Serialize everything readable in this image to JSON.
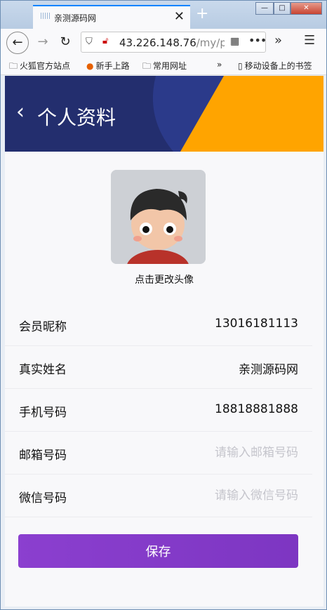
{
  "browser": {
    "tab_title": "亲测源码网",
    "url_host": "43.226.148.76",
    "url_path": "/my/prof",
    "bookmarks": [
      "火狐官方站点",
      "新手上路",
      "常用网址",
      "移动设备上的书签"
    ]
  },
  "header": {
    "title": "个人资料",
    "bg_color": "#232e6e",
    "accent_color": "#ffa400"
  },
  "avatar": {
    "caption": "点击更改头像"
  },
  "fields": [
    {
      "label": "会员昵称",
      "value": "13016181113"
    },
    {
      "label": "真实姓名",
      "value": "亲测源码网"
    },
    {
      "label": "手机号码",
      "value": "18818881888"
    },
    {
      "label": "邮箱号码",
      "placeholder": "请输入邮箱号码"
    },
    {
      "label": "微信号码",
      "placeholder": "请输入微信号码"
    }
  ],
  "save_button": {
    "label": "保存",
    "color": "#8b3fcf"
  }
}
